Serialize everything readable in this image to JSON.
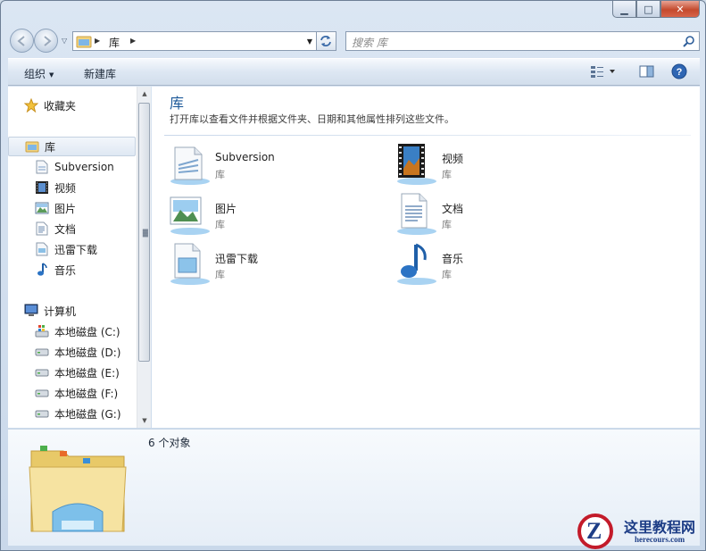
{
  "window": {
    "caption": {
      "minimize": "▁",
      "maximize": "□",
      "close": "✕"
    }
  },
  "address": {
    "crumb": "库",
    "search_placeholder": "搜索 库"
  },
  "toolbar": {
    "organize_label": "组织",
    "new_library_label": "新建库"
  },
  "nav_pane": {
    "favorites": "收藏夹",
    "libraries": "库",
    "library_items": [
      "Subversion",
      "视频",
      "图片",
      "文档",
      "迅雷下载",
      "音乐"
    ],
    "computer": "计算机",
    "drives": [
      "本地磁盘 (C:)",
      "本地磁盘 (D:)",
      "本地磁盘 (E:)",
      "本地磁盘 (F:)",
      "本地磁盘 (G:)"
    ]
  },
  "content": {
    "title": "库",
    "subtitle": "打开库以查看文件并根据文件夹、日期和其他属性排列这些文件。",
    "tiles": [
      {
        "name": "Subversion",
        "type": "库"
      },
      {
        "name": "视频",
        "type": "库"
      },
      {
        "name": "图片",
        "type": "库"
      },
      {
        "name": "文档",
        "type": "库"
      },
      {
        "name": "迅雷下载",
        "type": "库"
      },
      {
        "name": "音乐",
        "type": "库"
      }
    ]
  },
  "details": {
    "count": "6 个对象"
  },
  "watermark": {
    "cn": "这里教程网",
    "en": "herecours.com"
  },
  "colors": {
    "accent": "#1e5a9a",
    "close": "#c44a2e"
  }
}
